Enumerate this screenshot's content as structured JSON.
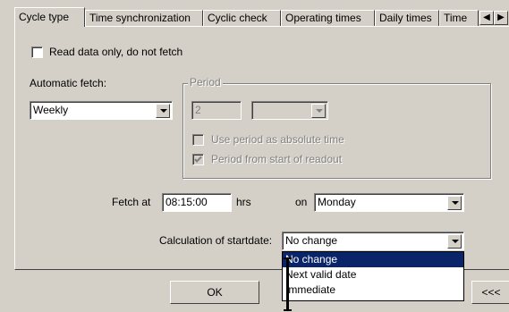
{
  "tabs": [
    {
      "label": "Cycle type",
      "active": true
    },
    {
      "label": "Time synchronization",
      "active": false
    },
    {
      "label": "Cyclic check",
      "active": false
    },
    {
      "label": "Operating times",
      "active": false
    },
    {
      "label": "Daily times",
      "active": false
    },
    {
      "label": "Time",
      "active": false
    }
  ],
  "tab_scroll": {
    "left": "◀",
    "right": "▶"
  },
  "read_only": {
    "label": "Read data only, do not fetch",
    "checked": false
  },
  "automatic_fetch": {
    "label": "Automatic fetch:",
    "value": "Weekly"
  },
  "period": {
    "title": "Period",
    "value": "2",
    "unit_value": "",
    "absolute_time": {
      "label": "Use period as absolute time",
      "checked": false
    },
    "from_start": {
      "label": "Period from start of readout",
      "checked": true
    }
  },
  "fetch": {
    "label": "Fetch at",
    "time": "08:15:00",
    "unit": "hrs",
    "on_label": "on",
    "day": "Monday"
  },
  "startdate": {
    "label": "Calculation of startdate:",
    "value": "No change",
    "options": [
      "No change",
      "Next valid date",
      "Immediate"
    ],
    "selected_index": 0
  },
  "buttons": {
    "ok": "OK",
    "more": "<<<"
  },
  "colors": {
    "face": "#d4d0c8",
    "highlight": "#0a246a"
  }
}
